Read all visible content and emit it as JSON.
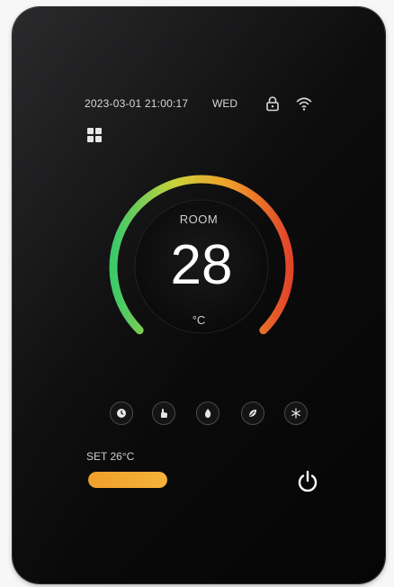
{
  "status": {
    "datetime": "2023-03-01 21:00:17",
    "weekday": "WED",
    "lock_icon": "lock-icon",
    "wifi_icon": "wifi-icon"
  },
  "menu_icon": "grid-icon",
  "dial": {
    "label": "ROOM",
    "temperature": "28",
    "unit": "°C",
    "gradient_colors": [
      "#3cc96a",
      "#c9d23a",
      "#f0a02a",
      "#e2452a"
    ]
  },
  "modes": [
    {
      "icon": "clock-icon"
    },
    {
      "icon": "hand-icon"
    },
    {
      "icon": "flame-icon"
    },
    {
      "icon": "leaf-icon"
    },
    {
      "icon": "snowflake-icon"
    }
  ],
  "setpoint": {
    "label": "SET 26°C",
    "fill_fraction": 1.0,
    "color": "#f0a02a"
  },
  "power_icon": "power-icon"
}
